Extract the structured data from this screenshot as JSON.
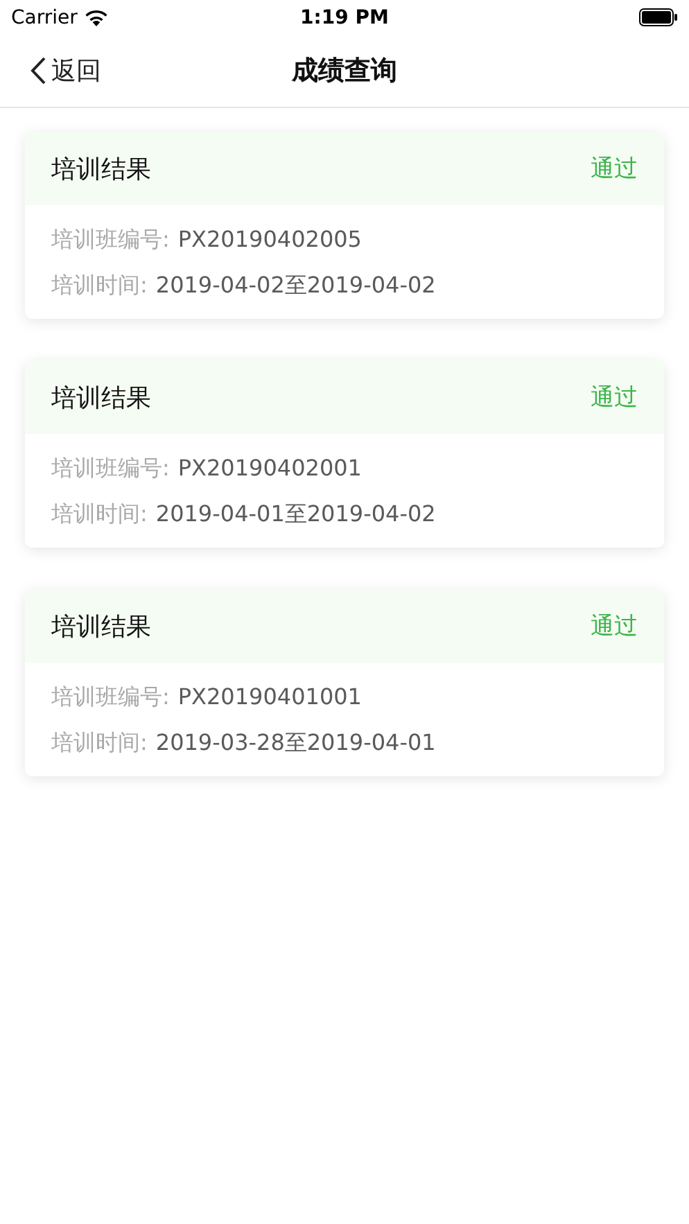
{
  "status_bar": {
    "carrier": "Carrier",
    "time": "1:19 PM"
  },
  "nav": {
    "back": "返回",
    "title": "成绩查询"
  },
  "cards": [
    {
      "title": "培训结果",
      "status": "通过",
      "fields": [
        {
          "label": "培训班编号:",
          "value": "PX20190402005"
        },
        {
          "label": "培训时间:",
          "value": "2019-04-02至2019-04-02"
        }
      ]
    },
    {
      "title": "培训结果",
      "status": "通过",
      "fields": [
        {
          "label": "培训班编号:",
          "value": "PX20190402001"
        },
        {
          "label": "培训时间:",
          "value": "2019-04-01至2019-04-02"
        }
      ]
    },
    {
      "title": "培训结果",
      "status": "通过",
      "fields": [
        {
          "label": "培训班编号:",
          "value": "PX20190401001"
        },
        {
          "label": "培训时间:",
          "value": "2019-03-28至2019-04-01"
        }
      ]
    }
  ]
}
